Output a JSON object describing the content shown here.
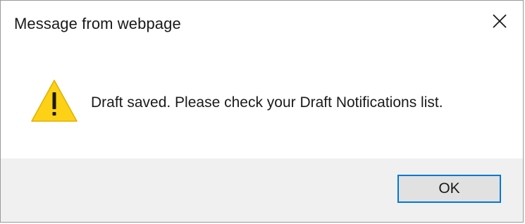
{
  "dialog": {
    "title": "Message from webpage",
    "close_icon": "close-icon",
    "message": "Draft saved. Please check your Draft Notifications list.",
    "status_icon": "warning-icon",
    "ok_label": "OK"
  },
  "colors": {
    "warning_fill": "#FCD116",
    "warning_mark": "#1a1a1a",
    "footer_bg": "#f0f0f0",
    "button_focus_border": "#0078d7",
    "button_bg": "#e1e1e1"
  }
}
